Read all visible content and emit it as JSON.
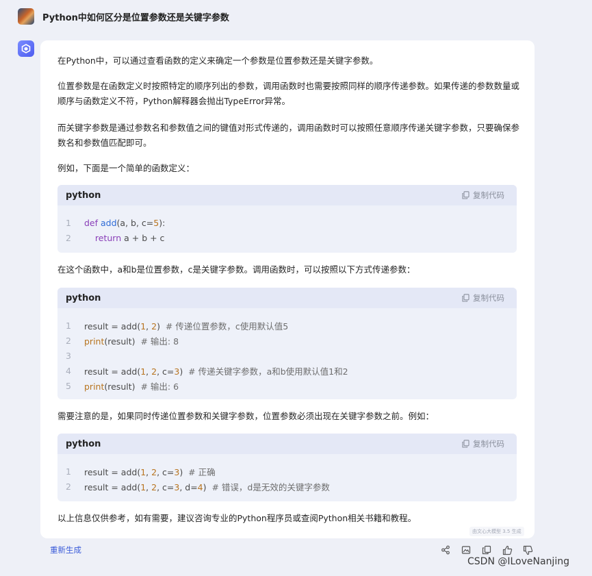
{
  "question": {
    "text": "Python中如何区分是位置参数还是关键字参数"
  },
  "answer": {
    "p1": "在Python中，可以通过查看函数的定义来确定一个参数是位置参数还是关键字参数。",
    "p2": "位置参数是在函数定义时按照特定的顺序列出的参数，调用函数时也需要按照同样的顺序传递参数。如果传递的参数数量或顺序与函数定义不符，Python解释器会抛出TypeError异常。",
    "p3": "而关键字参数是通过参数名和参数值之间的键值对形式传递的，调用函数时可以按照任意顺序传递关键字参数，只要确保参数名和参数值匹配即可。",
    "p4": "例如，下面是一个简单的函数定义：",
    "p5": "在这个函数中，a和b是位置参数，c是关键字参数。调用函数时，可以按照以下方式传递参数：",
    "p6": "需要注意的是，如果同时传递位置参数和关键字参数，位置参数必须出现在关键字参数之前。例如：",
    "p7": "以上信息仅供参考，如有需要，建议咨询专业的Python程序员或查阅Python相关书籍和教程。"
  },
  "code_label": "python",
  "copy_label": "复制代码",
  "code1": {
    "ln": [
      "1",
      "2"
    ],
    "l1": {
      "kw": "def",
      "fn": "add",
      "a": "(a, b, c=",
      "n": "5",
      "b": "):"
    },
    "l2": {
      "kw": "return",
      "rest": " a + b + c"
    }
  },
  "code2": {
    "ln": [
      "1",
      "2",
      "3",
      "4",
      "5"
    ],
    "l1": {
      "a": "result = add(",
      "n1": "1",
      "b": ", ",
      "n2": "2",
      "c": ")  ",
      "cm": "# 传递位置参数，c使用默认值5"
    },
    "l2": {
      "bi": "print",
      "a": "(result)  ",
      "cm": "# 输出: 8"
    },
    "l4": {
      "a": "result = add(",
      "n1": "1",
      "b": ", ",
      "n2": "2",
      "c": ", c=",
      "n3": "3",
      "d": ")  ",
      "cm": "# 传递关键字参数，a和b使用默认值1和2"
    },
    "l5": {
      "bi": "print",
      "a": "(result)  ",
      "cm": "# 输出: 6"
    }
  },
  "code3": {
    "ln": [
      "1",
      "2"
    ],
    "l1": {
      "a": "result = add(",
      "n1": "1",
      "b": ", ",
      "n2": "2",
      "c": ", c=",
      "n3": "3",
      "d": ")  ",
      "cm": "# 正确"
    },
    "l2": {
      "a": "result = add(",
      "n1": "1",
      "b": ", ",
      "n2": "2",
      "c": ", c=",
      "n3": "3",
      "d": ", d=",
      "n4": "4",
      "e": ")  ",
      "cm": "# 错误，d是无效的关键字参数"
    }
  },
  "regenerate": "重新生成",
  "model_badge": "由文心大模型 3.5 生成",
  "watermark": "CSDN @ILoveNanjing",
  "icons": [
    "share-icon",
    "image-icon",
    "copy-icon",
    "thumbs-up-icon",
    "thumbs-down-icon"
  ]
}
